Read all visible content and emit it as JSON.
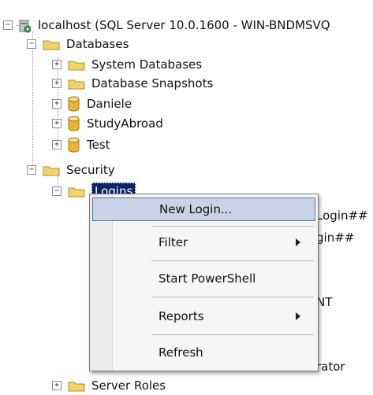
{
  "tree": {
    "root": {
      "label": "localhost (SQL Server 10.0.1600 - WIN-BNDMSVQ",
      "expander": "⊟"
    },
    "databases": {
      "label": "Databases",
      "expander": "−"
    },
    "system_databases": {
      "label": "System Databases",
      "expander": "+"
    },
    "database_snapshots": {
      "label": "Database Snapshots",
      "expander": "+"
    },
    "db_daniele": {
      "label": "Daniele",
      "expander": "+"
    },
    "db_studyabroad": {
      "label": "StudyAbroad",
      "expander": "+"
    },
    "db_test": {
      "label": "Test",
      "expander": "+"
    },
    "security": {
      "label": "Security",
      "expander": "−"
    },
    "logins": {
      "label": "Logins",
      "expander": "−"
    },
    "login_partials": [
      "Login##",
      "gin##",
      "NT",
      "rator"
    ],
    "server_roles": {
      "label": "Server Roles",
      "expander": "+"
    }
  },
  "context_menu": {
    "items": [
      {
        "label": "New Login..."
      },
      {
        "label": "Filter",
        "submenu": true
      },
      {
        "label": "Start PowerShell"
      },
      {
        "label": "Reports",
        "submenu": true
      },
      {
        "label": "Refresh"
      }
    ]
  },
  "colors": {
    "folder": "#f2d36b",
    "database": "#e8b43a",
    "selection": "#0a246a",
    "menu_highlight": "#c9d3e6"
  }
}
